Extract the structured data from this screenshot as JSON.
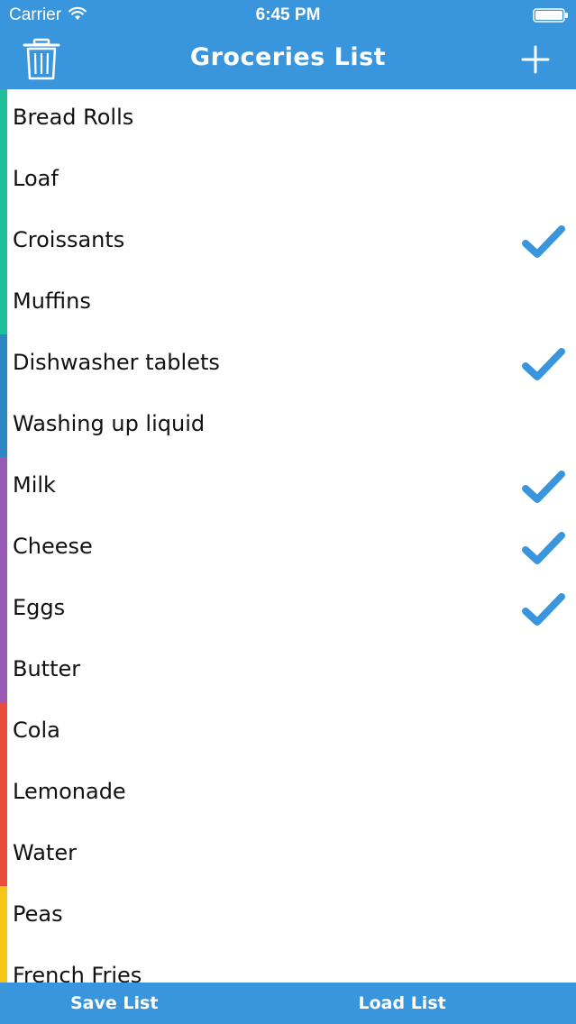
{
  "status_bar": {
    "carrier": "Carrier",
    "time": "6:45 PM"
  },
  "nav": {
    "title": "Groceries List",
    "left_icon": "trash-icon",
    "right_icon": "plus-icon"
  },
  "colors": {
    "accent": "#3a96dc",
    "check": "#3a96dc",
    "group_bakery": "#1fbf9a",
    "group_household": "#2f86c5",
    "group_dairy": "#9b59b6",
    "group_drinks": "#e74c3c",
    "group_frozen": "#f5c518"
  },
  "items": [
    {
      "label": "Bread Rolls",
      "checked": false,
      "color": "#1fbf9a"
    },
    {
      "label": "Loaf",
      "checked": false,
      "color": "#1fbf9a"
    },
    {
      "label": "Croissants",
      "checked": true,
      "color": "#1fbf9a"
    },
    {
      "label": "Muffins",
      "checked": false,
      "color": "#1fbf9a"
    },
    {
      "label": "Dishwasher tablets",
      "checked": true,
      "color": "#2f86c5"
    },
    {
      "label": "Washing up liquid",
      "checked": false,
      "color": "#2f86c5"
    },
    {
      "label": "Milk",
      "checked": true,
      "color": "#9b59b6"
    },
    {
      "label": "Cheese",
      "checked": true,
      "color": "#9b59b6"
    },
    {
      "label": "Eggs",
      "checked": true,
      "color": "#9b59b6"
    },
    {
      "label": "Butter",
      "checked": false,
      "color": "#9b59b6"
    },
    {
      "label": "Cola",
      "checked": false,
      "color": "#e74c3c"
    },
    {
      "label": "Lemonade",
      "checked": false,
      "color": "#e74c3c"
    },
    {
      "label": "Water",
      "checked": false,
      "color": "#e74c3c"
    },
    {
      "label": "Peas",
      "checked": false,
      "color": "#f5c518"
    },
    {
      "label": "French Fries",
      "checked": false,
      "color": "#f5c518"
    }
  ],
  "bottom_bar": {
    "save_label": "Save List",
    "load_label": "Load List"
  }
}
